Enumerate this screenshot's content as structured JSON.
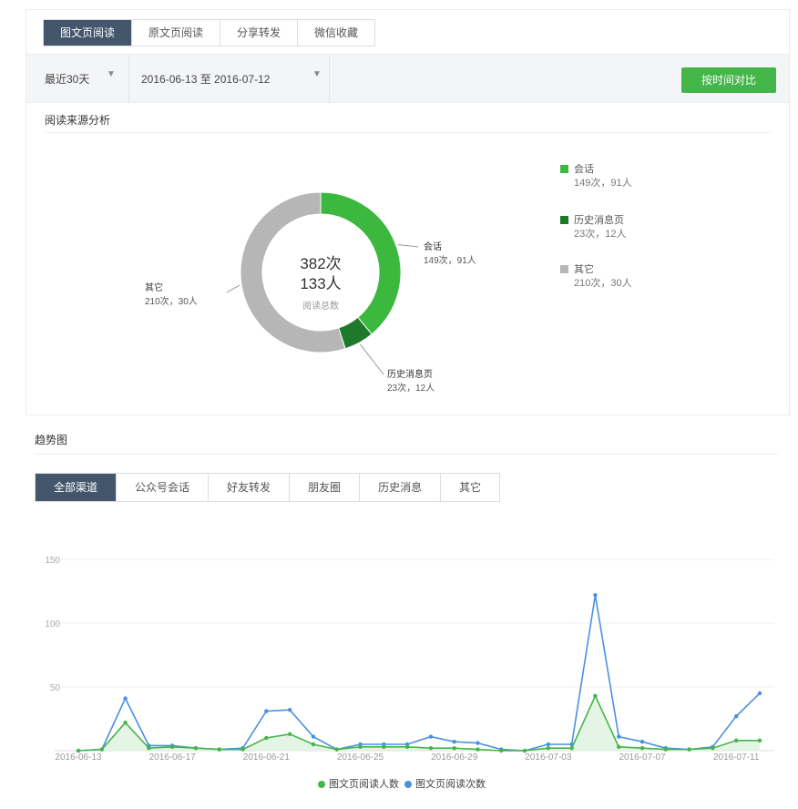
{
  "top_tabs": [
    "图文页阅读",
    "原文页阅读",
    "分享转发",
    "微信收藏"
  ],
  "top_active": 0,
  "range": {
    "label": "最近30天",
    "caret": "▼"
  },
  "date_range": {
    "label": "2016-06-13 至 2016-07-12",
    "caret": "▼"
  },
  "compare_button": "按时间对比",
  "source_section_title": "阅读来源分析",
  "donut": {
    "total_times": "382次",
    "total_people": "133人",
    "caption": "阅读总数",
    "segments": [
      {
        "name": "会话",
        "detail": "149次，91人",
        "value": 149,
        "color": "#3cb83f"
      },
      {
        "name": "历史消息页",
        "detail": "23次，12人",
        "value": 23,
        "color": "#1e7a2b"
      },
      {
        "name": "其它",
        "detail": "210次，30人",
        "value": 210,
        "color": "#b6b6b6"
      }
    ]
  },
  "legend": [
    {
      "name": "会话",
      "detail": "149次，91人",
      "color": "#3cb83f"
    },
    {
      "name": "历史消息页",
      "detail": "23次，12人",
      "color": "#1e7a2b"
    },
    {
      "name": "其它",
      "detail": "210次，30人",
      "color": "#b6b6b6"
    }
  ],
  "trend_title": "趋势图",
  "channel_tabs": [
    "全部渠道",
    "公众号会话",
    "好友转发",
    "朋友圈",
    "历史消息",
    "其它"
  ],
  "channel_active": 0,
  "chart_data": {
    "type": "line",
    "x": [
      "2016-06-13",
      "2016-06-14",
      "2016-06-15",
      "2016-06-16",
      "2016-06-17",
      "2016-06-18",
      "2016-06-19",
      "2016-06-20",
      "2016-06-21",
      "2016-06-22",
      "2016-06-23",
      "2016-06-24",
      "2016-06-25",
      "2016-06-26",
      "2016-06-27",
      "2016-06-28",
      "2016-06-29",
      "2016-06-30",
      "2016-07-01",
      "2016-07-02",
      "2016-07-03",
      "2016-07-04",
      "2016-07-05",
      "2016-07-06",
      "2016-07-07",
      "2016-07-08",
      "2016-07-09",
      "2016-07-10",
      "2016-07-11",
      "2016-07-12"
    ],
    "xticks": [
      "2016-06-13",
      "2016-06-17",
      "2016-06-21",
      "2016-06-25",
      "2016-06-29",
      "2016-07-03",
      "2016-07-07",
      "2016-07-11"
    ],
    "yticks": [
      50,
      100,
      150
    ],
    "ylim": [
      0,
      150
    ],
    "series": [
      {
        "name": "图文页阅读人数",
        "color": "#44b549",
        "values": [
          0,
          1,
          22,
          2,
          3,
          2,
          1,
          1,
          10,
          13,
          5,
          1,
          3,
          3,
          3,
          2,
          2,
          1,
          0,
          0,
          2,
          2,
          43,
          3,
          2,
          1,
          1,
          2,
          8,
          8
        ]
      },
      {
        "name": "图文页阅读次数",
        "color": "#4a90e2",
        "values": [
          0,
          1,
          41,
          4,
          4,
          2,
          1,
          2,
          31,
          32,
          11,
          1,
          5,
          5,
          5,
          11,
          7,
          6,
          1,
          0,
          5,
          5,
          122,
          11,
          7,
          2,
          1,
          3,
          27,
          45
        ]
      }
    ]
  }
}
